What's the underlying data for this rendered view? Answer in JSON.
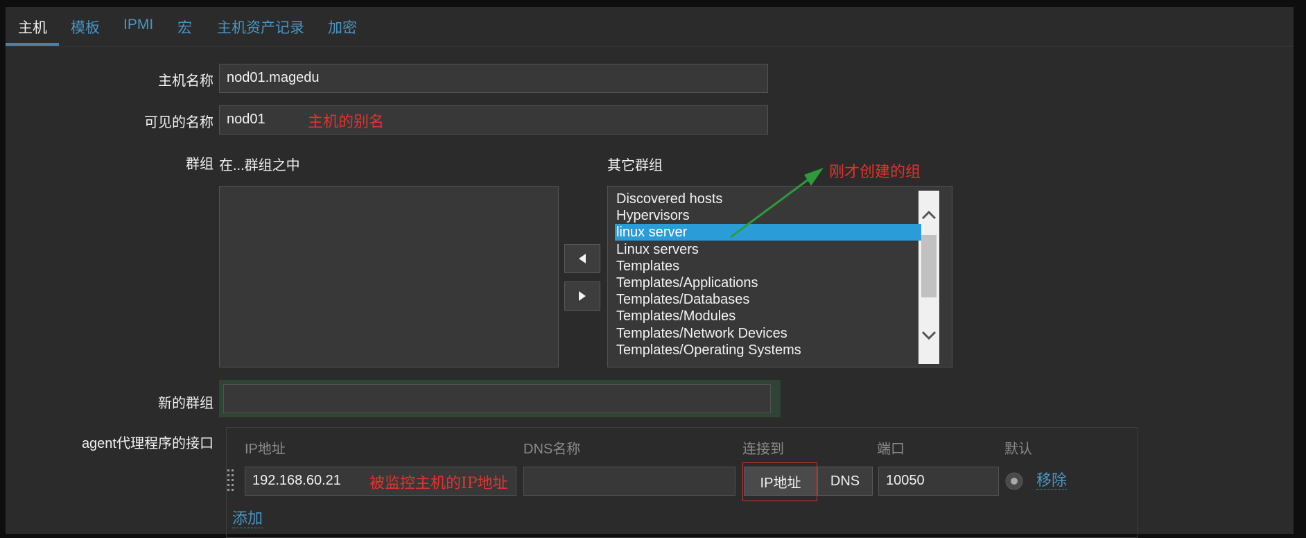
{
  "tabs": [
    {
      "label": "主机"
    },
    {
      "label": "模板"
    },
    {
      "label": "IPMI"
    },
    {
      "label": "宏"
    },
    {
      "label": "主机资产记录"
    },
    {
      "label": "加密"
    }
  ],
  "form": {
    "host_name_label": "主机名称",
    "host_name_value": "nod01.magedu",
    "visible_name_label": "可见的名称",
    "visible_name_value": "nod01",
    "visible_name_annotation": "主机的别名",
    "groups_label": "群组",
    "in_groups_label": "在...群组之中",
    "other_groups_label": "其它群组",
    "other_groups_annotation": "刚才创建的组",
    "in_groups": [],
    "other_groups": [
      "Discovered hosts",
      "Hypervisors",
      "linux server",
      "Linux servers",
      "Templates",
      "Templates/Applications",
      "Templates/Databases",
      "Templates/Modules",
      "Templates/Network Devices",
      "Templates/Operating Systems"
    ],
    "other_groups_selected": "linux server",
    "new_group_label": "新的群组",
    "new_group_value": ""
  },
  "agent_interface": {
    "label": "agent代理程序的接口",
    "col_ip": "IP地址",
    "col_dns": "DNS名称",
    "col_connect": "连接到",
    "col_port": "端口",
    "col_default": "默认",
    "ip_value": "192.168.60.21",
    "ip_annotation": "被监控主机的IP地址",
    "dns_value": "",
    "connect_ip_label": "IP地址",
    "connect_dns_label": "DNS",
    "port_value": "10050",
    "remove_label": "移除",
    "add_label": "添加"
  },
  "colors": {
    "accent": "#4796c4",
    "selected": "#2a9dd8",
    "annotation": "#e3322f",
    "arrow": "#2e9b3a"
  },
  "icons": {
    "move_left": "triangle-left-icon",
    "move_right": "triangle-right-icon",
    "scroll_up": "chevron-up-icon",
    "scroll_down": "chevron-down-icon",
    "drag": "drag-handle-icon",
    "default_radio": "radio-icon"
  }
}
